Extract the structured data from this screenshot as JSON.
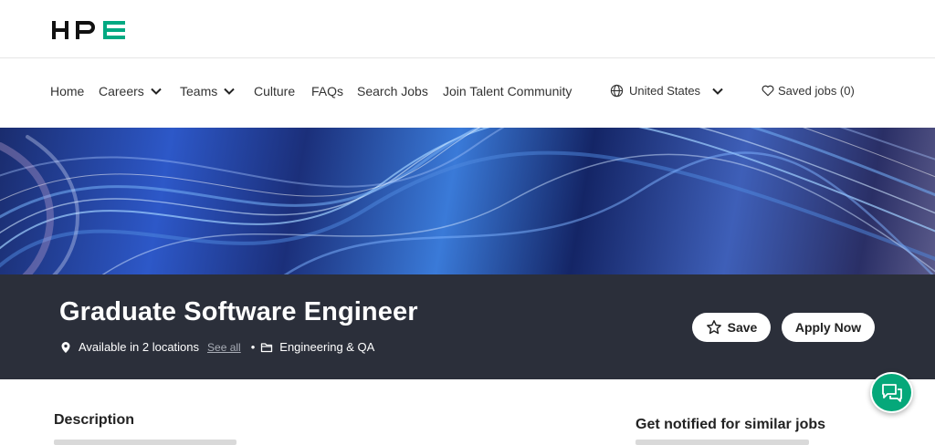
{
  "logo": {
    "text": "HPE",
    "accent_color": "#01a982"
  },
  "nav": {
    "home": "Home",
    "careers": "Careers",
    "teams": "Teams",
    "culture": "Culture",
    "faqs": "FAQs",
    "search_jobs": "Search Jobs",
    "join_talent": "Join Talent Community",
    "country": "United States",
    "saved_jobs": "Saved jobs (0)"
  },
  "job": {
    "title": "Graduate Software Engineer",
    "locations": "Available in 2 locations",
    "see_all": "See all",
    "separator": "•",
    "category": "Engineering & QA"
  },
  "actions": {
    "save": "Save",
    "apply": "Apply Now"
  },
  "content": {
    "description_heading": "Description",
    "notify_heading": "Get notified for similar jobs"
  },
  "colors": {
    "banner": "#2b2f3a",
    "chat": "#05a87a"
  },
  "icons": [
    "globe-icon",
    "heart-icon",
    "chevron-down-icon",
    "location-pin-icon",
    "folder-icon",
    "star-icon",
    "chat-icon"
  ]
}
